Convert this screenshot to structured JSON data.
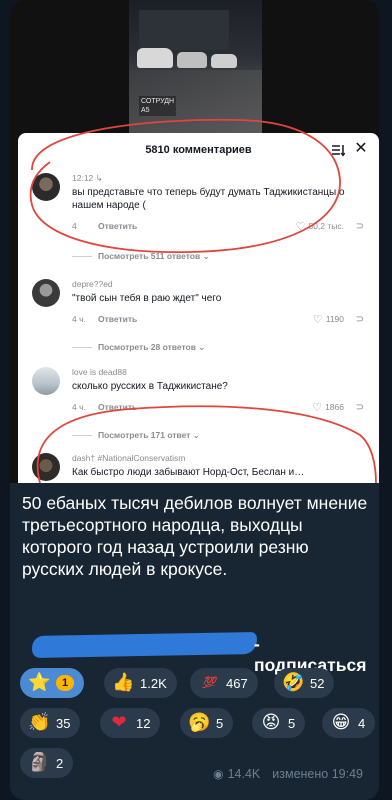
{
  "screenshot": {
    "video": {
      "overlay_text": "СОТРУДН\nА5"
    },
    "sheet": {
      "title": "5810 комментариев",
      "comments": [
        {
          "user": "",
          "time_user": "12:12 ↳",
          "text": "вы представьте что теперь будут думать Таджикистанцы о нашем народе (",
          "time": "4",
          "reply": "Ответить",
          "likes": "50,2 тыс.",
          "replies": "Посмотреть 511 ответов ⌄"
        },
        {
          "user": "depre??ed",
          "text": "\"твой сын тебя в раю ждет\" чего",
          "time": "4 ч.",
          "reply": "Ответить",
          "likes": "1190",
          "replies": "Посмотреть 28 ответов ⌄"
        },
        {
          "user": "love is dead88",
          "text": "сколько русских в Таджикистане?",
          "time": "4 ч.",
          "reply": "Ответить",
          "likes": "1866",
          "replies": "Посмотреть 171 ответ ⌄"
        },
        {
          "user": "dash† #NationalConservatism",
          "text": "Как быстро люди забывают Норд-Ост, Беслан и…"
        }
      ]
    }
  },
  "message": {
    "text": "50 ебаных тысяч дебилов волнует мнение третьесортного народца, выходцы которого год назад устроили резню русских людей в крокусе.",
    "subscribe": "- подписаться"
  },
  "reactions": [
    {
      "emoji": "⭐",
      "count": "1",
      "active": true
    },
    {
      "emoji": "👍",
      "count": "1.2K"
    },
    {
      "emoji": "💯",
      "count": "467"
    },
    {
      "emoji": "🤣",
      "count": "52"
    },
    {
      "emoji": "👏",
      "count": "35"
    },
    {
      "emoji": "❤",
      "count": "12"
    },
    {
      "emoji": "🥱",
      "count": "5"
    },
    {
      "emoji": "😡",
      "count": "5"
    },
    {
      "emoji": "😁",
      "count": "4"
    },
    {
      "emoji": "🗿",
      "count": "2"
    }
  ],
  "footer": {
    "views": "14.4K",
    "edited": "изменено 19:49"
  },
  "colors": {
    "accent": "#4c8ad3",
    "background": "#0e1621",
    "bubble": "#182533",
    "annotation": "#e0463c"
  }
}
